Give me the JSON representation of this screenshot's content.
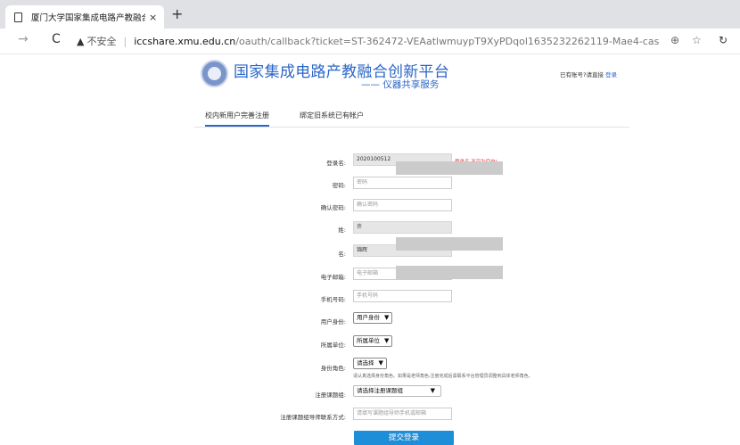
{
  "browser": {
    "tab_title": "厦门大学国家集成电路产教融合创新",
    "new_tab": "+",
    "close_tab": "×",
    "nav_back": "→",
    "nav_reload": "C",
    "security_label": "不安全",
    "url_host": "iccshare.xmu.edu.cn",
    "url_path": "/oauth/callback?ticket=ST-362472-VEAatlwmuypT9XyPDqol1635232262119-Mae4-cas",
    "icons": [
      "document-icon",
      "back-icon",
      "reload-icon",
      "warning-icon",
      "zoom-icon",
      "favorite-icon",
      "refresh-icon"
    ]
  },
  "header": {
    "brand_title": "国家集成电路产教融合创新平台",
    "brand_subtitle": "—— 仪器共享服务",
    "login_hint": "已有账号?请直接",
    "login_link": "登录"
  },
  "tabs": [
    {
      "label": "校内新用户完善注册",
      "active": true
    },
    {
      "label": "绑定旧系统已有帐户",
      "active": false
    }
  ],
  "form": {
    "username_label": "登录名:",
    "username_value": "2020100512",
    "username_error": "登录名,不可为空白!",
    "password_label": "密码:",
    "password_placeholder": "密码",
    "confirm_label": "确认密码:",
    "confirm_placeholder": "确认密码",
    "surname_label": "姓:",
    "surname_value": "许",
    "givenname_label": "名:",
    "givenname_value": "锦辉",
    "email_label": "电子邮箱:",
    "email_placeholder": "电子邮箱",
    "phone_label": "手机号码:",
    "phone_placeholder": "手机号码",
    "identity_label": "用户身份:",
    "identity_value": "用户身份",
    "unit_label": "所属单位:",
    "unit_value": "所属单位",
    "role_label": "身份角色:",
    "role_value": "请选择",
    "role_note": "请认真选择身份角色。如果是老师角色,注册完成后需联系平台管理员调整到具体老师角色。",
    "group_label": "注册课题组:",
    "group_value": "请选择注册课题组",
    "advisor_label": "注册课题组导师联系方式:",
    "advisor_placeholder": "请填写课题组导师手机或邮箱",
    "submit_label": "提交登录"
  }
}
